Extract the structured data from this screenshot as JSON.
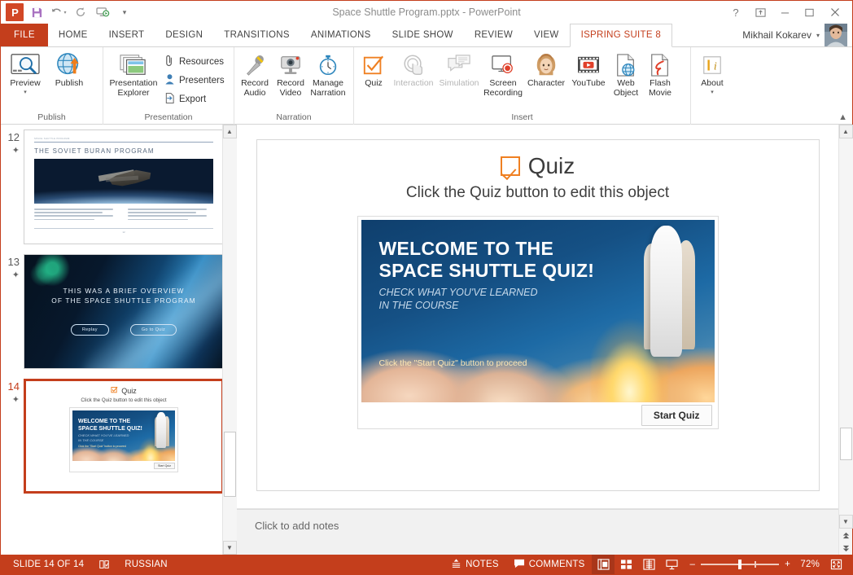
{
  "window": {
    "title": "Space Shuttle Program.pptx - PowerPoint",
    "quick_access": [
      {
        "name": "powerpoint-logo",
        "label": "P"
      },
      {
        "name": "save-icon",
        "label": "Save"
      },
      {
        "name": "undo-icon",
        "label": "Undo"
      },
      {
        "name": "redo-icon",
        "label": "Redo"
      },
      {
        "name": "start-presentation-icon",
        "label": "Start From Beginning"
      },
      {
        "name": "customize-quick-access-icon",
        "label": "Customize Quick Access Toolbar"
      }
    ],
    "controls": [
      {
        "name": "help-button",
        "glyph": "?"
      },
      {
        "name": "ribbon-display-options-button",
        "glyph": "⬚"
      },
      {
        "name": "minimize-button",
        "glyph": "—"
      },
      {
        "name": "maximize-button",
        "glyph": "❐"
      },
      {
        "name": "close-button",
        "glyph": "✕"
      }
    ]
  },
  "tabs": {
    "file": "FILE",
    "items": [
      "HOME",
      "INSERT",
      "DESIGN",
      "TRANSITIONS",
      "ANIMATIONS",
      "SLIDE SHOW",
      "REVIEW",
      "VIEW"
    ],
    "active": "ISPRING SUITE 8"
  },
  "account": {
    "user_name": "Mikhail Kokarev",
    "caret": "▾"
  },
  "ribbon": {
    "groups": [
      {
        "name": "publish",
        "label": "Publish",
        "buttons": [
          {
            "name": "preview-button",
            "label": "Preview",
            "icon": "preview-magnifier-icon",
            "has_caret": true,
            "disabled": false
          },
          {
            "name": "publish-button",
            "label": "Publish",
            "icon": "publish-globe-icon",
            "has_caret": false,
            "disabled": false
          }
        ]
      },
      {
        "name": "presentation",
        "label": "Presentation",
        "buttons": [
          {
            "name": "presentation-explorer-button",
            "label": "Presentation Explorer",
            "icon": "presentation-explorer-icon",
            "has_caret": false,
            "disabled": false
          }
        ],
        "small_buttons": [
          {
            "name": "resources-button",
            "label": "Resources",
            "icon": "paperclip-icon"
          },
          {
            "name": "presenters-button",
            "label": "Presenters",
            "icon": "person-icon"
          },
          {
            "name": "export-button",
            "label": "Export",
            "icon": "export-arrow-icon"
          }
        ]
      },
      {
        "name": "narration",
        "label": "Narration",
        "buttons": [
          {
            "name": "record-audio-button",
            "label": "Record Audio",
            "icon": "microphone-icon",
            "disabled": false
          },
          {
            "name": "record-video-button",
            "label": "Record Video",
            "icon": "webcam-icon",
            "disabled": false
          },
          {
            "name": "manage-narration-button",
            "label": "Manage Narration",
            "icon": "stopwatch-icon",
            "disabled": false
          }
        ]
      },
      {
        "name": "insert",
        "label": "Insert",
        "buttons": [
          {
            "name": "quiz-button",
            "label": "Quiz",
            "icon": "quiz-checkbox-icon",
            "disabled": false
          },
          {
            "name": "interaction-button",
            "label": "Interaction",
            "icon": "interaction-tap-icon",
            "disabled": true
          },
          {
            "name": "simulation-button",
            "label": "Simulation",
            "icon": "simulation-dialog-icon",
            "disabled": true
          },
          {
            "name": "screen-recording-button",
            "label": "Screen Recording",
            "icon": "screen-record-icon",
            "disabled": false
          },
          {
            "name": "character-button",
            "label": "Character",
            "icon": "character-face-icon",
            "disabled": false
          },
          {
            "name": "youtube-button",
            "label": "YouTube",
            "icon": "youtube-film-icon",
            "disabled": false
          },
          {
            "name": "web-object-button",
            "label": "Web Object",
            "icon": "web-object-icon",
            "disabled": false
          },
          {
            "name": "flash-movie-button",
            "label": "Flash Movie",
            "icon": "flash-movie-icon",
            "disabled": false
          }
        ]
      },
      {
        "name": "about",
        "label": "",
        "buttons": [
          {
            "name": "about-button",
            "label": "About",
            "icon": "about-info-icon",
            "has_caret": true,
            "disabled": false
          }
        ]
      }
    ],
    "collapse_icon": "collapse-ribbon-icon"
  },
  "thumbnails": [
    {
      "number": "12",
      "selected": false,
      "kicker": "SPACE SHUTTLE PROGRAM",
      "title": "THE SOVIET BURAN PROGRAM",
      "page_marker": "12"
    },
    {
      "number": "13",
      "selected": false,
      "line1": "THIS WAS A BRIEF OVERVIEW",
      "line2": "OF THE SPACE SHUTTLE PROGRAM",
      "buttons": [
        "Replay",
        "Go to Quiz"
      ]
    },
    {
      "number": "14",
      "selected": true,
      "title": "Quiz",
      "subtitle": "Click the Quiz button to edit this object",
      "card_button": "Start Quiz"
    }
  ],
  "slide": {
    "title": "Quiz",
    "subtitle_prefix": "Click the ",
    "subtitle_bold": "Quiz",
    "subtitle_suffix": " button to edit this object",
    "quiz_card": {
      "heading_line1": "WELCOME TO THE",
      "heading_line2": "SPACE SHUTTLE QUIZ!",
      "subheading_line1": "CHECK WHAT YOU'VE LEARNED",
      "subheading_line2": "IN THE COURSE",
      "cta": "Click the \"Start Quiz\" button to proceed",
      "start_button": "Start Quiz"
    }
  },
  "notes": {
    "placeholder": "Click to add notes"
  },
  "status": {
    "slide_counter": "SLIDE 14 OF 14",
    "language": "RUSSIAN",
    "notes_label": "NOTES",
    "comments_label": "COMMENTS",
    "zoom_percent": "72%",
    "zoom_minus": "–",
    "zoom_plus": "+",
    "view_buttons": [
      {
        "name": "normal-view-button",
        "icon": "normal-view-icon",
        "active": true
      },
      {
        "name": "slide-sorter-view-button",
        "icon": "slide-sorter-icon",
        "active": false
      },
      {
        "name": "reading-view-button",
        "icon": "reading-view-icon",
        "active": false
      },
      {
        "name": "slide-show-button",
        "icon": "slide-show-icon",
        "active": false
      }
    ],
    "fit-to-window": "fit-slide-icon"
  },
  "colors": {
    "accent": "#c43e1c",
    "quiz_orange": "#ef8022",
    "tab_text": "#444444"
  }
}
